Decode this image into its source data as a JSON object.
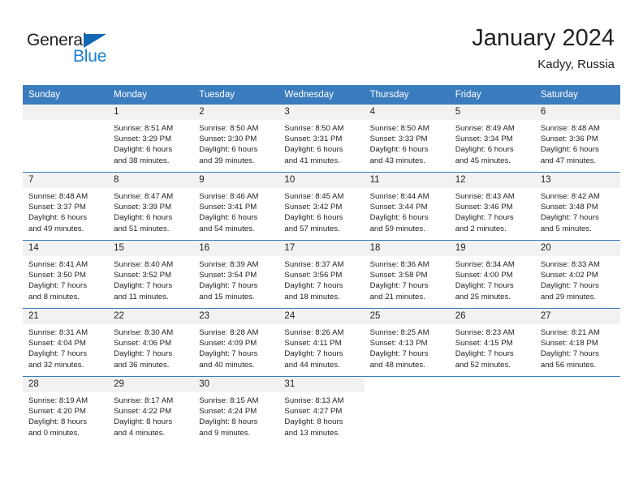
{
  "brand": {
    "name_dark": "General",
    "name_blue": "Blue",
    "color_dark": "#231f20",
    "color_blue": "#1a7fd4",
    "triangle_color": "#1268b3"
  },
  "header": {
    "title": "January 2024",
    "location": "Kadyy, Russia"
  },
  "theme": {
    "header_row_bg": "#3a7cbe",
    "daynum_bg": "#f2f2f2",
    "text": "#231f20"
  },
  "weekday_headers": [
    "Sunday",
    "Monday",
    "Tuesday",
    "Wednesday",
    "Thursday",
    "Friday",
    "Saturday"
  ],
  "labels": {
    "sunrise_prefix": "Sunrise:",
    "sunset_prefix": "Sunset:",
    "daylight_prefix": "Daylight:"
  },
  "weeks": [
    [
      {
        "day": "",
        "empty": true,
        "blank": false,
        "line1": "",
        "line2": "",
        "line3": "",
        "line4": ""
      },
      {
        "day": "1",
        "line1": "Sunrise: 8:51 AM",
        "line2": "Sunset: 3:29 PM",
        "line3": "Daylight: 6 hours",
        "line4": "and 38 minutes."
      },
      {
        "day": "2",
        "line1": "Sunrise: 8:50 AM",
        "line2": "Sunset: 3:30 PM",
        "line3": "Daylight: 6 hours",
        "line4": "and 39 minutes."
      },
      {
        "day": "3",
        "line1": "Sunrise: 8:50 AM",
        "line2": "Sunset: 3:31 PM",
        "line3": "Daylight: 6 hours",
        "line4": "and 41 minutes."
      },
      {
        "day": "4",
        "line1": "Sunrise: 8:50 AM",
        "line2": "Sunset: 3:33 PM",
        "line3": "Daylight: 6 hours",
        "line4": "and 43 minutes."
      },
      {
        "day": "5",
        "line1": "Sunrise: 8:49 AM",
        "line2": "Sunset: 3:34 PM",
        "line3": "Daylight: 6 hours",
        "line4": "and 45 minutes."
      },
      {
        "day": "6",
        "line1": "Sunrise: 8:48 AM",
        "line2": "Sunset: 3:36 PM",
        "line3": "Daylight: 6 hours",
        "line4": "and 47 minutes."
      }
    ],
    [
      {
        "day": "7",
        "line1": "Sunrise: 8:48 AM",
        "line2": "Sunset: 3:37 PM",
        "line3": "Daylight: 6 hours",
        "line4": "and 49 minutes."
      },
      {
        "day": "8",
        "line1": "Sunrise: 8:47 AM",
        "line2": "Sunset: 3:39 PM",
        "line3": "Daylight: 6 hours",
        "line4": "and 51 minutes."
      },
      {
        "day": "9",
        "line1": "Sunrise: 8:46 AM",
        "line2": "Sunset: 3:41 PM",
        "line3": "Daylight: 6 hours",
        "line4": "and 54 minutes."
      },
      {
        "day": "10",
        "line1": "Sunrise: 8:45 AM",
        "line2": "Sunset: 3:42 PM",
        "line3": "Daylight: 6 hours",
        "line4": "and 57 minutes."
      },
      {
        "day": "11",
        "line1": "Sunrise: 8:44 AM",
        "line2": "Sunset: 3:44 PM",
        "line3": "Daylight: 6 hours",
        "line4": "and 59 minutes."
      },
      {
        "day": "12",
        "line1": "Sunrise: 8:43 AM",
        "line2": "Sunset: 3:46 PM",
        "line3": "Daylight: 7 hours",
        "line4": "and 2 minutes."
      },
      {
        "day": "13",
        "line1": "Sunrise: 8:42 AM",
        "line2": "Sunset: 3:48 PM",
        "line3": "Daylight: 7 hours",
        "line4": "and 5 minutes."
      }
    ],
    [
      {
        "day": "14",
        "line1": "Sunrise: 8:41 AM",
        "line2": "Sunset: 3:50 PM",
        "line3": "Daylight: 7 hours",
        "line4": "and 8 minutes."
      },
      {
        "day": "15",
        "line1": "Sunrise: 8:40 AM",
        "line2": "Sunset: 3:52 PM",
        "line3": "Daylight: 7 hours",
        "line4": "and 11 minutes."
      },
      {
        "day": "16",
        "line1": "Sunrise: 8:39 AM",
        "line2": "Sunset: 3:54 PM",
        "line3": "Daylight: 7 hours",
        "line4": "and 15 minutes."
      },
      {
        "day": "17",
        "line1": "Sunrise: 8:37 AM",
        "line2": "Sunset: 3:56 PM",
        "line3": "Daylight: 7 hours",
        "line4": "and 18 minutes."
      },
      {
        "day": "18",
        "line1": "Sunrise: 8:36 AM",
        "line2": "Sunset: 3:58 PM",
        "line3": "Daylight: 7 hours",
        "line4": "and 21 minutes."
      },
      {
        "day": "19",
        "line1": "Sunrise: 8:34 AM",
        "line2": "Sunset: 4:00 PM",
        "line3": "Daylight: 7 hours",
        "line4": "and 25 minutes."
      },
      {
        "day": "20",
        "line1": "Sunrise: 8:33 AM",
        "line2": "Sunset: 4:02 PM",
        "line3": "Daylight: 7 hours",
        "line4": "and 29 minutes."
      }
    ],
    [
      {
        "day": "21",
        "line1": "Sunrise: 8:31 AM",
        "line2": "Sunset: 4:04 PM",
        "line3": "Daylight: 7 hours",
        "line4": "and 32 minutes."
      },
      {
        "day": "22",
        "line1": "Sunrise: 8:30 AM",
        "line2": "Sunset: 4:06 PM",
        "line3": "Daylight: 7 hours",
        "line4": "and 36 minutes."
      },
      {
        "day": "23",
        "line1": "Sunrise: 8:28 AM",
        "line2": "Sunset: 4:09 PM",
        "line3": "Daylight: 7 hours",
        "line4": "and 40 minutes."
      },
      {
        "day": "24",
        "line1": "Sunrise: 8:26 AM",
        "line2": "Sunset: 4:11 PM",
        "line3": "Daylight: 7 hours",
        "line4": "and 44 minutes."
      },
      {
        "day": "25",
        "line1": "Sunrise: 8:25 AM",
        "line2": "Sunset: 4:13 PM",
        "line3": "Daylight: 7 hours",
        "line4": "and 48 minutes."
      },
      {
        "day": "26",
        "line1": "Sunrise: 8:23 AM",
        "line2": "Sunset: 4:15 PM",
        "line3": "Daylight: 7 hours",
        "line4": "and 52 minutes."
      },
      {
        "day": "27",
        "line1": "Sunrise: 8:21 AM",
        "line2": "Sunset: 4:18 PM",
        "line3": "Daylight: 7 hours",
        "line4": "and 56 minutes."
      }
    ],
    [
      {
        "day": "28",
        "line1": "Sunrise: 8:19 AM",
        "line2": "Sunset: 4:20 PM",
        "line3": "Daylight: 8 hours",
        "line4": "and 0 minutes."
      },
      {
        "day": "29",
        "line1": "Sunrise: 8:17 AM",
        "line2": "Sunset: 4:22 PM",
        "line3": "Daylight: 8 hours",
        "line4": "and 4 minutes."
      },
      {
        "day": "30",
        "line1": "Sunrise: 8:15 AM",
        "line2": "Sunset: 4:24 PM",
        "line3": "Daylight: 8 hours",
        "line4": "and 9 minutes."
      },
      {
        "day": "31",
        "line1": "Sunrise: 8:13 AM",
        "line2": "Sunset: 4:27 PM",
        "line3": "Daylight: 8 hours",
        "line4": "and 13 minutes."
      },
      {
        "day": "",
        "blank": true,
        "line1": "",
        "line2": "",
        "line3": "",
        "line4": ""
      },
      {
        "day": "",
        "blank": true,
        "line1": "",
        "line2": "",
        "line3": "",
        "line4": ""
      },
      {
        "day": "",
        "blank": true,
        "line1": "",
        "line2": "",
        "line3": "",
        "line4": ""
      }
    ]
  ]
}
